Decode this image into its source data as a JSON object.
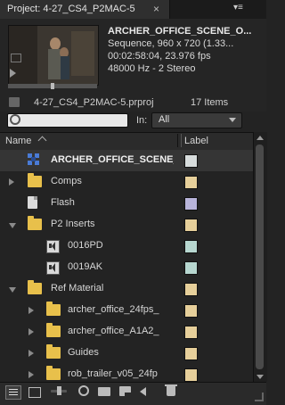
{
  "panel": {
    "tab_title": "Project: 4-27_CS4_P2MAC-5",
    "close_glyph": "×",
    "menu_glyph": "▾≡"
  },
  "preview": {
    "clip_name": "ARCHER_OFFICE_SCENE_O...",
    "sequence_info": "Sequence, 960 x 720 (1.33...",
    "timecode_info": "00:02:58:04, 23.976 fps",
    "audio_info": "48000 Hz - 2 Stereo"
  },
  "project": {
    "file_name": "4-27_CS4_P2MAC-5.prproj",
    "item_count": "17 Items"
  },
  "search": {
    "value": "",
    "in_label": "In:",
    "in_selected": "All"
  },
  "columns": {
    "name": "Name",
    "label": "Label"
  },
  "rows": [
    {
      "name": "ARCHER_OFFICE_SCENE_C",
      "icon": "sequence-icon",
      "indent": 1,
      "triangle": "none",
      "label_color": "#d7dcdc",
      "selected": true
    },
    {
      "name": "Comps",
      "icon": "bin-icon",
      "indent": 0,
      "triangle": "closed",
      "label_color": "#e6cf9a",
      "selected": false
    },
    {
      "name": "Flash",
      "icon": "document-icon",
      "indent": 1,
      "triangle": "none",
      "label_color": "#b8b4da",
      "selected": false
    },
    {
      "name": "P2 Inserts",
      "icon": "bin-icon",
      "indent": 0,
      "triangle": "open",
      "label_color": "#e6cf9a",
      "selected": false
    },
    {
      "name": "0016PD",
      "icon": "audio-clip-icon",
      "indent": 2,
      "triangle": "none",
      "label_color": "#b7d7d0",
      "selected": false
    },
    {
      "name": "0019AK",
      "icon": "audio-clip-icon",
      "indent": 2,
      "triangle": "none",
      "label_color": "#b7d7d0",
      "selected": false
    },
    {
      "name": "Ref Material",
      "icon": "bin-icon",
      "indent": 0,
      "triangle": "open",
      "label_color": "#e6cf9a",
      "selected": false
    },
    {
      "name": "archer_office_24fps_",
      "icon": "bin-icon",
      "indent": 1,
      "triangle": "closed",
      "label_color": "#e6cf9a",
      "selected": false
    },
    {
      "name": "archer_office_A1A2_",
      "icon": "bin-icon",
      "indent": 1,
      "triangle": "closed",
      "label_color": "#e6cf9a",
      "selected": false
    },
    {
      "name": "Guides",
      "icon": "bin-icon",
      "indent": 1,
      "triangle": "closed",
      "label_color": "#e6cf9a",
      "selected": false
    },
    {
      "name": "rob_trailer_v05_24fp",
      "icon": "bin-icon",
      "indent": 1,
      "triangle": "closed",
      "label_color": "#e6cf9a",
      "selected": false
    }
  ],
  "toolbar": {
    "icons": [
      "list-view-icon",
      "icon-view-icon",
      "zoom-slider",
      "find-icon",
      "new-bin-icon",
      "new-item-icon",
      "navigate-back-icon",
      "trash-icon"
    ]
  }
}
